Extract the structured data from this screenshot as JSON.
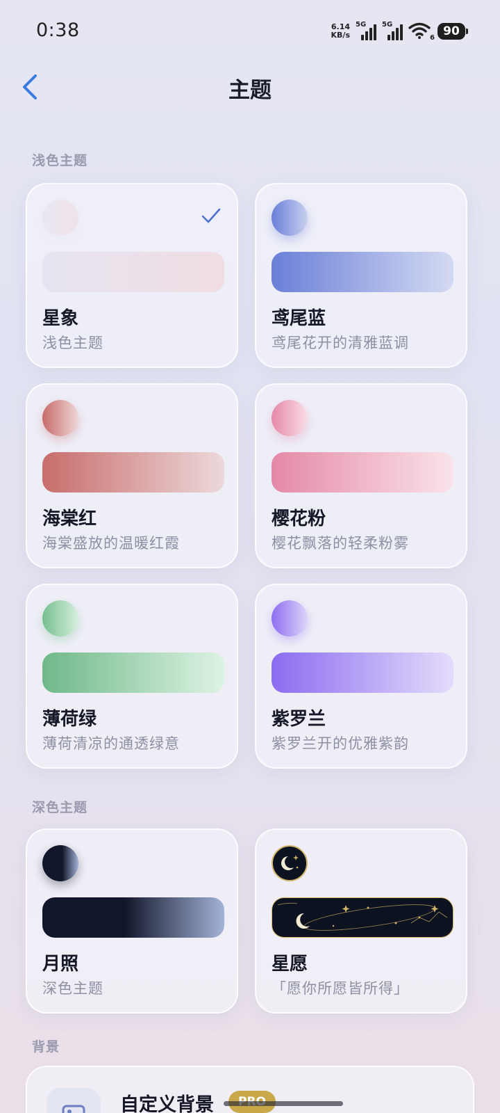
{
  "status_bar": {
    "time": "0:38",
    "net_speed_value": "6.14",
    "net_speed_unit": "KB/s",
    "sim1_label": "5G",
    "sim2_label": "5G",
    "wifi_sub": "6",
    "battery": "90"
  },
  "header": {
    "title": "主题",
    "back_icon": "chevron-left-icon"
  },
  "sections": {
    "light_label": "浅色主题",
    "dark_label": "深色主题",
    "background_label": "背景"
  },
  "light_themes": [
    {
      "name": "星象",
      "desc": "浅色主题",
      "selected": true,
      "dot_colors": [
        "#e8e8f2",
        "#f0e2ea"
      ],
      "bar_colors": [
        "#e6e4f0",
        "#f0dde3"
      ]
    },
    {
      "name": "鸢尾蓝",
      "desc": "鸢尾花开的清雅蓝调",
      "selected": false,
      "dot_colors": [
        "#6a7fd8",
        "#c8d0ef"
      ],
      "bar_colors": [
        "#6a7fd8",
        "#d4daf2"
      ]
    },
    {
      "name": "海棠红",
      "desc": "海棠盛放的温暖红霞",
      "selected": false,
      "dot_colors": [
        "#c86d6b",
        "#eed6d6"
      ],
      "bar_colors": [
        "#c86d6b",
        "#ecd8da"
      ]
    },
    {
      "name": "樱花粉",
      "desc": "樱花飘落的轻柔粉雾",
      "selected": false,
      "dot_colors": [
        "#e489a8",
        "#f8dde6"
      ],
      "bar_colors": [
        "#e489a8",
        "#fbe3ea"
      ]
    },
    {
      "name": "薄荷绿",
      "desc": "薄荷清凉的通透绿意",
      "selected": false,
      "dot_colors": [
        "#76bf8f",
        "#d6efdd"
      ],
      "bar_colors": [
        "#6fb88a",
        "#ddf3e3"
      ]
    },
    {
      "name": "紫罗兰",
      "desc": "紫罗兰开的优雅紫韵",
      "selected": false,
      "dot_colors": [
        "#8d6ef0",
        "#ddd4fa"
      ],
      "bar_colors": [
        "#8b6cf0",
        "#e4dcfb"
      ]
    }
  ],
  "dark_themes": [
    {
      "name": "月照",
      "desc": "深色主题",
      "selected": false,
      "dot_colors": [
        "#12162a",
        "#a3b3d8"
      ],
      "bar_colors": [
        "#12162a",
        "#a3b3d8"
      ]
    },
    {
      "name": "星愿",
      "desc": "「愿你所愿皆所得」",
      "selected": false,
      "dot_colors": [
        "#0c1220",
        "#0c1220"
      ],
      "bar_colors": [
        "#0c1220",
        "#0c1220"
      ],
      "accent": "#d3b56a"
    }
  ],
  "custom_background": {
    "title": "自定义背景",
    "badge": "PRO",
    "icon": "image-icon"
  }
}
